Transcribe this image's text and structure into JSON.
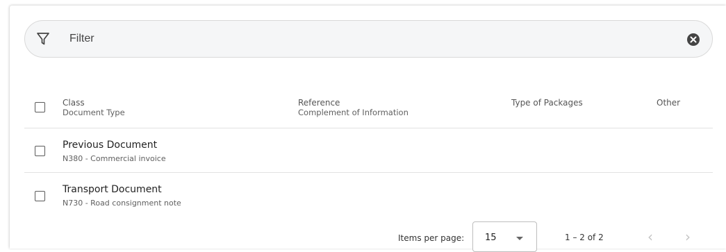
{
  "filter": {
    "placeholder": "Filter",
    "value": ""
  },
  "table": {
    "columns": [
      {
        "primary": "Class",
        "secondary": "Document Type"
      },
      {
        "primary": "Reference",
        "secondary": "Complement of Information"
      },
      {
        "primary": "Type of Packages",
        "secondary": ""
      },
      {
        "primary": "Other",
        "secondary": ""
      }
    ],
    "rows": [
      {
        "title": "Previous Document",
        "subtitle": "N380 - Commercial invoice"
      },
      {
        "title": "Transport Document",
        "subtitle": "N730 - Road consignment note"
      }
    ]
  },
  "paginator": {
    "items_per_page_label": "Items per page:",
    "page_size": "15",
    "range": "1 – 2 of 2",
    "prev_icon": "chevron-left-icon",
    "next_icon": "chevron-right-icon",
    "prev_glyph": "‹",
    "next_glyph": "›"
  },
  "colors": {
    "filter_background": "#f5f6f7",
    "text_primary": "#222222",
    "text_secondary": "#5f5f5f",
    "disabled": "#c4c4c4"
  }
}
